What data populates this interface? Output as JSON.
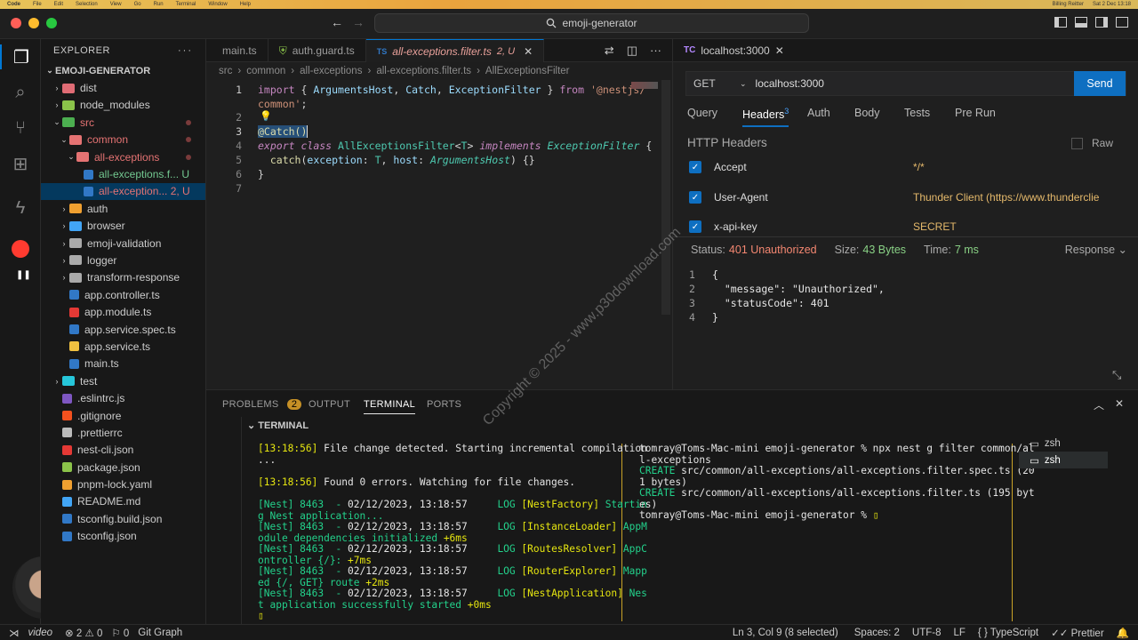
{
  "menubar": {
    "app": "Code",
    "items": [
      "File",
      "Edit",
      "Selection",
      "View",
      "Go",
      "Run",
      "Terminal",
      "Window",
      "Help"
    ],
    "clock": "Sat 2 Dec 13:18",
    "user": "Billing Reitter"
  },
  "titlebar": {
    "search": "emoji-generator"
  },
  "explorer": {
    "title": "EXPLORER",
    "root": "EMOJI-GENERATOR",
    "items": [
      {
        "label": "dist",
        "indent": 1,
        "type": "folder",
        "color": "#e06c75",
        "chev": "›"
      },
      {
        "label": "node_modules",
        "indent": 1,
        "type": "folder",
        "color": "#8bc34a",
        "chev": "›"
      },
      {
        "label": "src",
        "indent": 1,
        "type": "folder",
        "color": "#4caf50",
        "chev": "⌄",
        "labelColor": "#e57373",
        "dot": true
      },
      {
        "label": "common",
        "indent": 2,
        "type": "folder",
        "color": "#e57373",
        "chev": "⌄",
        "labelColor": "#e57373",
        "dot": true
      },
      {
        "label": "all-exceptions",
        "indent": 3,
        "type": "folder",
        "color": "#e57373",
        "chev": "⌄",
        "labelColor": "#e57373",
        "dot": true
      },
      {
        "label": "all-exceptions.f... U",
        "indent": 4,
        "type": "ts",
        "color": "#3178c6",
        "labelColor": "#73c991"
      },
      {
        "label": "all-exception... 2, U",
        "indent": 4,
        "type": "ts",
        "color": "#3178c6",
        "labelColor": "#e57373",
        "selected": true
      },
      {
        "label": "auth",
        "indent": 2,
        "type": "folder",
        "color": "#f0a030",
        "chev": "›"
      },
      {
        "label": "browser",
        "indent": 2,
        "type": "folder",
        "color": "#42a5f5",
        "chev": "›"
      },
      {
        "label": "emoji-validation",
        "indent": 2,
        "type": "folder",
        "color": "#aaaaaa",
        "chev": "›"
      },
      {
        "label": "logger",
        "indent": 2,
        "type": "folder",
        "color": "#aaaaaa",
        "chev": "›"
      },
      {
        "label": "transform-response",
        "indent": 2,
        "type": "folder",
        "color": "#aaaaaa",
        "chev": "›"
      },
      {
        "label": "app.controller.ts",
        "indent": 2,
        "type": "ts",
        "color": "#3178c6"
      },
      {
        "label": "app.module.ts",
        "indent": 2,
        "type": "ts",
        "color": "#e53935"
      },
      {
        "label": "app.service.spec.ts",
        "indent": 2,
        "type": "ts",
        "color": "#3178c6"
      },
      {
        "label": "app.service.ts",
        "indent": 2,
        "type": "ts",
        "color": "#f0c040"
      },
      {
        "label": "main.ts",
        "indent": 2,
        "type": "ts",
        "color": "#3178c6"
      },
      {
        "label": "test",
        "indent": 1,
        "type": "folder",
        "color": "#26c6da",
        "chev": "›"
      },
      {
        "label": ".eslintrc.js",
        "indent": 1,
        "type": "file",
        "color": "#7e57c2"
      },
      {
        "label": ".gitignore",
        "indent": 1,
        "type": "file",
        "color": "#f4511e"
      },
      {
        "label": ".prettierrc",
        "indent": 1,
        "type": "file",
        "color": "#bbbbbb"
      },
      {
        "label": "nest-cli.json",
        "indent": 1,
        "type": "file",
        "color": "#e53935"
      },
      {
        "label": "package.json",
        "indent": 1,
        "type": "file",
        "color": "#8bc34a"
      },
      {
        "label": "pnpm-lock.yaml",
        "indent": 1,
        "type": "file",
        "color": "#f0a030"
      },
      {
        "label": "README.md",
        "indent": 1,
        "type": "file",
        "color": "#42a5f5"
      },
      {
        "label": "tsconfig.build.json",
        "indent": 1,
        "type": "file",
        "color": "#3178c6"
      },
      {
        "label": "tsconfig.json",
        "indent": 1,
        "type": "file",
        "color": "#3178c6"
      }
    ]
  },
  "editor": {
    "tabs": [
      {
        "label": "main.ts",
        "icon": "TS"
      },
      {
        "label": "auth.guard.ts",
        "icon": "TS"
      },
      {
        "label": "all-exceptions.filter.ts",
        "suffix": "2, U",
        "active": true
      }
    ],
    "breadcrumb": [
      "src",
      "common",
      "all-exceptions",
      "all-exceptions.filter.ts",
      "AllExceptionsFilter"
    ],
    "line_numbers": [
      "1",
      "2",
      "3",
      "4",
      "5",
      "6",
      "7"
    ]
  },
  "thunder": {
    "tab": "localhost:3000",
    "method": "GET",
    "url": "localhost:3000",
    "send": "Send",
    "subtabs": [
      "Query",
      "Headers",
      "Auth",
      "Body",
      "Tests",
      "Pre Run"
    ],
    "headers_count": "3",
    "section_title": "HTTP Headers",
    "raw": "Raw",
    "headers": [
      {
        "key": "Accept",
        "value": "*/*"
      },
      {
        "key": "User-Agent",
        "value": "Thunder Client (https://www.thunderclie"
      },
      {
        "key": "x-api-key",
        "value": "SECRET"
      }
    ],
    "status_label": "Status:",
    "status": "401 Unauthorized",
    "size_label": "Size:",
    "size": "43 Bytes",
    "time_label": "Time:",
    "time": "7 ms",
    "response_menu": "Response",
    "response_lines": [
      "{",
      "  \"message\": \"Unauthorized\",",
      "  \"statusCode\": 401",
      "}"
    ]
  },
  "panel": {
    "tabs": [
      "PROBLEMS",
      "OUTPUT",
      "TERMINAL",
      "PORTS"
    ],
    "problems_count": "2",
    "section": "TERMINAL",
    "shells": [
      "zsh",
      "zsh"
    ]
  },
  "status": {
    "errors": "2",
    "warnings": "0",
    "ports": "0",
    "git": "Git Graph",
    "position": "Ln 3, Col 9 (8 selected)",
    "spaces": "Spaces: 2",
    "encoding": "UTF-8",
    "eol": "LF",
    "language": "TypeScript",
    "prettier": "Prettier",
    "video": "video"
  },
  "watermark": "Copyright © 2025 - www.p30download.com"
}
